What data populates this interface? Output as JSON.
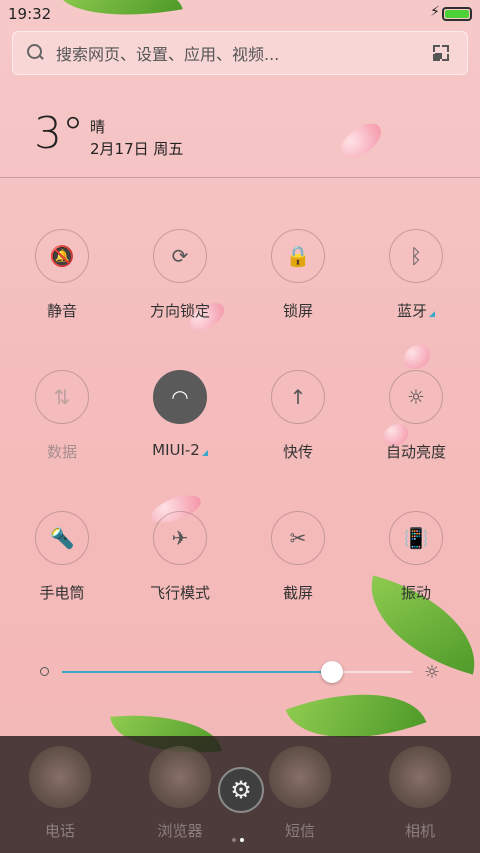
{
  "status_bar": {
    "time": "19:32",
    "battery_level": 1.0
  },
  "search": {
    "placeholder": "搜索网页、设置、应用、视频..."
  },
  "weather": {
    "temperature": "3°",
    "condition": "晴",
    "date": "2月17日 周五"
  },
  "toggles": [
    {
      "label": "静音",
      "icon": "silent-icon",
      "glyph": "🔕",
      "active": false,
      "enabled": true
    },
    {
      "label": "方向锁定",
      "icon": "rotation-lock-icon",
      "glyph": "⟳",
      "active": false,
      "enabled": true
    },
    {
      "label": "锁屏",
      "icon": "lock-icon",
      "glyph": "🔒",
      "active": false,
      "enabled": true
    },
    {
      "label": "蓝牙",
      "icon": "bluetooth-icon",
      "glyph": "ᛒ",
      "active": false,
      "enabled": true,
      "has_more": true
    },
    {
      "label": "数据",
      "icon": "mobile-data-icon",
      "glyph": "⇅",
      "active": false,
      "enabled": false
    },
    {
      "label": "MIUI-2",
      "icon": "wifi-icon",
      "glyph": "◠",
      "active": true,
      "enabled": true,
      "has_more": true
    },
    {
      "label": "快传",
      "icon": "transfer-icon",
      "glyph": "↑",
      "active": false,
      "enabled": true
    },
    {
      "label": "自动亮度",
      "icon": "auto-brightness-icon",
      "glyph": "☼",
      "active": false,
      "enabled": true
    },
    {
      "label": "手电筒",
      "icon": "flashlight-icon",
      "glyph": "🔦",
      "active": false,
      "enabled": true
    },
    {
      "label": "飞行模式",
      "icon": "airplane-icon",
      "glyph": "✈",
      "active": false,
      "enabled": true
    },
    {
      "label": "截屏",
      "icon": "screenshot-icon",
      "glyph": "✂",
      "active": false,
      "enabled": true
    },
    {
      "label": "振动",
      "icon": "vibrate-icon",
      "glyph": "📳",
      "active": false,
      "enabled": true
    }
  ],
  "brightness": {
    "level": 0.77
  },
  "dock": {
    "apps": [
      {
        "label": "电话",
        "icon": "phone-app-icon"
      },
      {
        "label": "浏览器",
        "icon": "browser-app-icon"
      },
      {
        "label": "短信",
        "icon": "messages-app-icon"
      },
      {
        "label": "相机",
        "icon": "camera-app-icon"
      }
    ],
    "settings_icon": "gear-icon",
    "page_indicator": {
      "count": 2,
      "current": 1
    }
  },
  "colors": {
    "accent": "#3aa9c7",
    "background": "#f4bcbc",
    "battery": "#4cd137"
  }
}
